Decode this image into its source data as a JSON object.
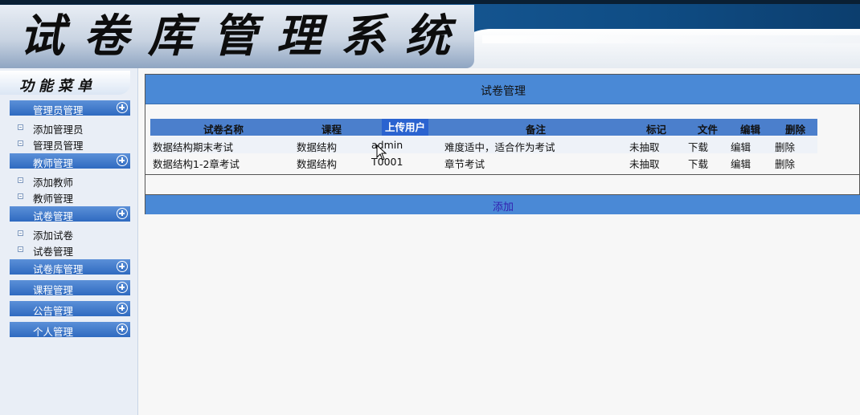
{
  "header": {
    "title": "试卷库管理系统"
  },
  "sidebar": {
    "menu_title": "功能菜单",
    "groups": [
      {
        "label": "管理员管理",
        "items": [
          "添加管理员",
          "管理员管理"
        ]
      },
      {
        "label": "教师管理",
        "items": [
          "添加教师",
          "教师管理"
        ]
      },
      {
        "label": "试卷管理",
        "items": [
          "添加试卷",
          "试卷管理"
        ]
      },
      {
        "label": "试卷库管理",
        "items": []
      },
      {
        "label": "课程管理",
        "items": []
      },
      {
        "label": "公告管理",
        "items": []
      },
      {
        "label": "个人管理",
        "items": []
      }
    ]
  },
  "main": {
    "title": "试卷管理",
    "table": {
      "headers": [
        "试卷名称",
        "课程",
        "上传用户",
        "备注",
        "标记",
        "文件",
        "编辑",
        "删除"
      ],
      "rows": [
        [
          "数据结构期末考试",
          "数据结构",
          "admin",
          "难度适中，适合作为考试",
          "未抽取",
          "下载",
          "编辑",
          "删除"
        ],
        [
          "数据结构1-2章考试",
          "数据结构",
          "T0001",
          "章节考试",
          "未抽取",
          "下载",
          "编辑",
          "删除"
        ]
      ]
    },
    "add_label": "添加"
  },
  "colors": {
    "header_blue": "#14548f",
    "panel_blue": "#4a89d6",
    "table_header_blue": "#4b7fcc",
    "menu_blue": "#2f6ac0",
    "add_link": "#3320b0"
  },
  "icons": {
    "group_toggle": "plus-circle-icon",
    "sub_item": "square-bullet-icon",
    "cursor": "mouse-pointer-icon"
  }
}
